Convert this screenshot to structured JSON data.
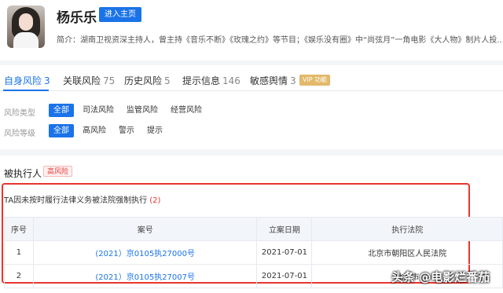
{
  "profile": {
    "name": "杨乐乐",
    "enter_button": "进入主页",
    "intro": "简介：湖南卫视资深主持人，曾主持《音乐不断》《玫瑰之约》等节目；《娱乐没有圈》中“尚弦月”一角电影《大人物》制片人投..."
  },
  "tabs": [
    {
      "label": "自身风险",
      "count": "3"
    },
    {
      "label": "关联风险",
      "count": "75"
    },
    {
      "label": "历史风险",
      "count": "5"
    },
    {
      "label": "提示信息",
      "count": "146"
    },
    {
      "label": "敏感舆情",
      "count": "3"
    }
  ],
  "vip_badge": "VIP 功能",
  "filters": {
    "type": {
      "label": "风险类型",
      "options": [
        "全部",
        "司法风险",
        "监管风险",
        "经营风险"
      ],
      "selected": "全部"
    },
    "level": {
      "label": "风险等级",
      "options": [
        "全部",
        "高风险",
        "警示",
        "提示"
      ],
      "selected": "全部"
    }
  },
  "section": {
    "title": "被执行人",
    "tag": "高风险"
  },
  "case": {
    "title": "TA因未按时履行法律义务被法院强制执行",
    "count": "(2)",
    "headers": [
      "序号",
      "案号",
      "立案日期",
      "执行法院"
    ],
    "rows": [
      {
        "index": "1",
        "case_no": "(2021）京0105执27000号",
        "date": "2021-07-01",
        "court": "北京市朝阳区人民法院"
      },
      {
        "index": "2",
        "case_no": "(2021）京0105执27007号",
        "date": "2021-07-01",
        "court": "北京市"
      }
    ]
  },
  "watermark": "头条 @电影烂番茄",
  "colors": {
    "accent": "#1a73e8",
    "danger": "#e8352f",
    "vip": "#e2b869"
  }
}
